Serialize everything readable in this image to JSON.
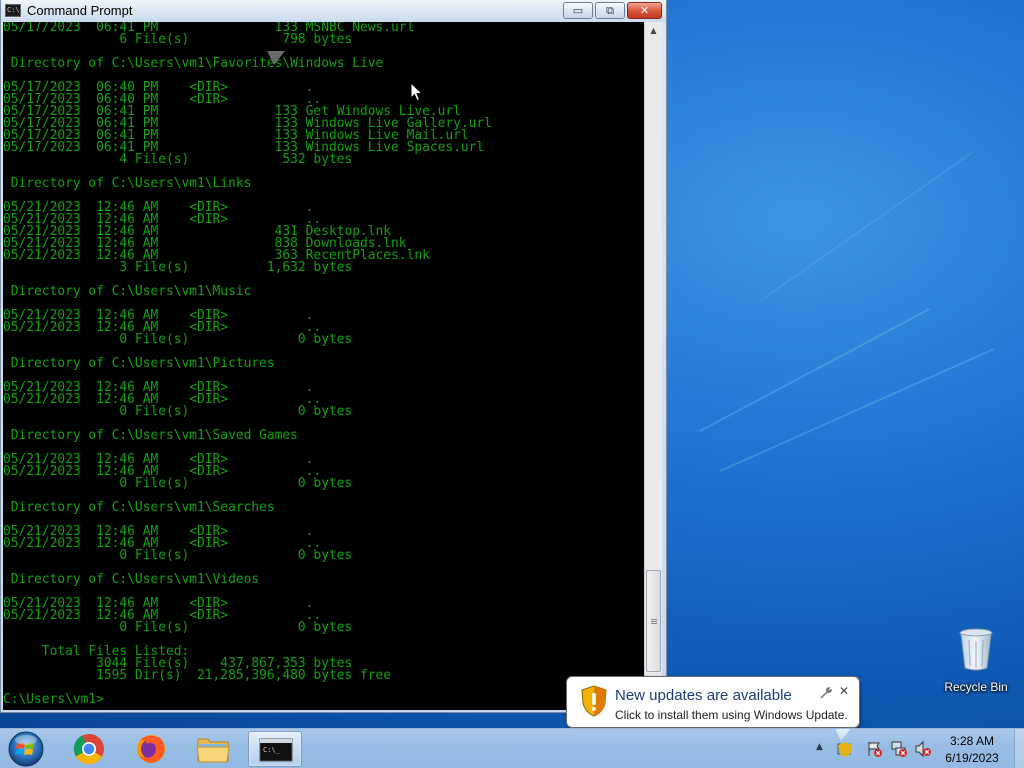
{
  "window": {
    "title": "Command Prompt",
    "icon_text": "C:\\",
    "min_symbol": "▭",
    "max_symbol": "⧉",
    "close_symbol": "✕"
  },
  "console": {
    "lines": [
      "05/17/2023  06:41 PM               133 MSNBC News.url",
      "               6 File(s)            798 bytes",
      "",
      " Directory of C:\\Users\\vm1\\Favorites\\Windows Live",
      "",
      "05/17/2023  06:40 PM    <DIR>          .",
      "05/17/2023  06:40 PM    <DIR>          ..",
      "05/17/2023  06:41 PM               133 Get Windows Live.url",
      "05/17/2023  06:41 PM               133 Windows Live Gallery.url",
      "05/17/2023  06:41 PM               133 Windows Live Mail.url",
      "05/17/2023  06:41 PM               133 Windows Live Spaces.url",
      "               4 File(s)            532 bytes",
      "",
      " Directory of C:\\Users\\vm1\\Links",
      "",
      "05/21/2023  12:46 AM    <DIR>          .",
      "05/21/2023  12:46 AM    <DIR>          ..",
      "05/21/2023  12:46 AM               431 Desktop.lnk",
      "05/21/2023  12:46 AM               838 Downloads.lnk",
      "05/21/2023  12:46 AM               363 RecentPlaces.lnk",
      "               3 File(s)          1,632 bytes",
      "",
      " Directory of C:\\Users\\vm1\\Music",
      "",
      "05/21/2023  12:46 AM    <DIR>          .",
      "05/21/2023  12:46 AM    <DIR>          ..",
      "               0 File(s)              0 bytes",
      "",
      " Directory of C:\\Users\\vm1\\Pictures",
      "",
      "05/21/2023  12:46 AM    <DIR>          .",
      "05/21/2023  12:46 AM    <DIR>          ..",
      "               0 File(s)              0 bytes",
      "",
      " Directory of C:\\Users\\vm1\\Saved Games",
      "",
      "05/21/2023  12:46 AM    <DIR>          .",
      "05/21/2023  12:46 AM    <DIR>          ..",
      "               0 File(s)              0 bytes",
      "",
      " Directory of C:\\Users\\vm1\\Searches",
      "",
      "05/21/2023  12:46 AM    <DIR>          .",
      "05/21/2023  12:46 AM    <DIR>          ..",
      "               0 File(s)              0 bytes",
      "",
      " Directory of C:\\Users\\vm1\\Videos",
      "",
      "05/21/2023  12:46 AM    <DIR>          .",
      "05/21/2023  12:46 AM    <DIR>          ..",
      "               0 File(s)              0 bytes",
      "",
      "     Total Files Listed:",
      "            3044 File(s)    437,867,353 bytes",
      "            1595 Dir(s)  21,285,396,480 bytes free",
      "",
      "C:\\Users\\vm1>"
    ],
    "text_color": "#13a10e",
    "background": "#000000"
  },
  "desktop": {
    "recycle_bin_label": "Recycle Bin"
  },
  "notification": {
    "title": "New updates are available",
    "text": "Click to install them using Windows Update.",
    "options_symbol": "🔧",
    "close_symbol": "✕"
  },
  "taskbar": {
    "apps": [
      "Google Chrome",
      "Firefox",
      "Windows Explorer",
      "Command Prompt"
    ],
    "tray_arrow": "▲",
    "clock_time": "3:28 AM",
    "clock_date": "6/19/2023"
  }
}
